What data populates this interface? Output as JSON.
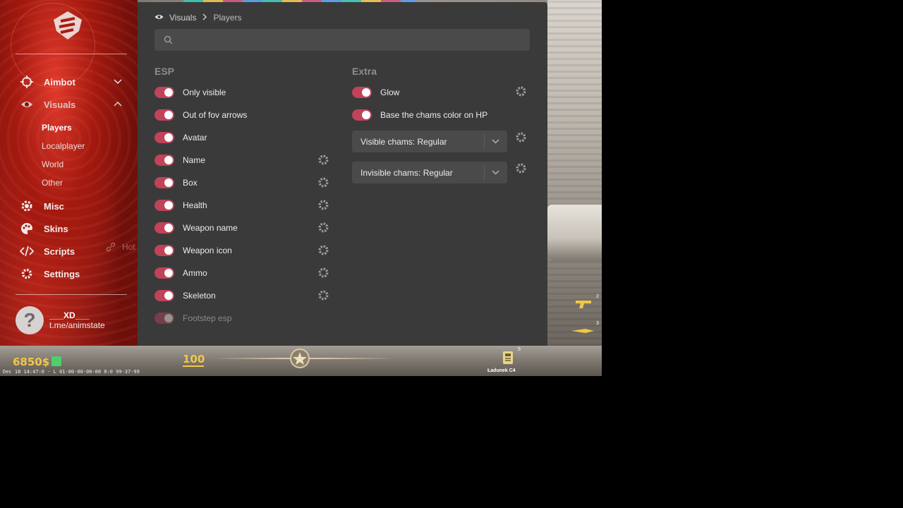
{
  "sidebar": {
    "nav": [
      {
        "label": "Aimbot",
        "icon": "crosshair-icon"
      },
      {
        "label": "Visuals",
        "icon": "eye-icon"
      },
      {
        "label": "Misc",
        "icon": "gear-icon"
      },
      {
        "label": "Skins",
        "icon": "palette-icon"
      },
      {
        "label": "Scripts",
        "icon": "code-icon"
      },
      {
        "label": "Settings",
        "icon": "settings-gear-icon"
      }
    ],
    "visuals_sub": [
      "Players",
      "Localplayer",
      "World",
      "Other"
    ],
    "ghost_hot": "Hot",
    "user": {
      "avatar_glyph": "?",
      "name": "___XD___",
      "link": "t.me/animstate"
    }
  },
  "breadcrumb": {
    "section": "Visuals",
    "page": "Players"
  },
  "search": {
    "placeholder": "",
    "value": ""
  },
  "esp": {
    "title": "ESP",
    "items": [
      {
        "label": "Only visible",
        "on": true,
        "gear": false
      },
      {
        "label": "Out of fov arrows",
        "on": true,
        "gear": false
      },
      {
        "label": "Avatar",
        "on": true,
        "gear": false
      },
      {
        "label": "Name",
        "on": true,
        "gear": true
      },
      {
        "label": "Box",
        "on": true,
        "gear": true
      },
      {
        "label": "Health",
        "on": true,
        "gear": true
      },
      {
        "label": "Weapon name",
        "on": true,
        "gear": true
      },
      {
        "label": "Weapon icon",
        "on": true,
        "gear": true
      },
      {
        "label": "Ammo",
        "on": true,
        "gear": true
      },
      {
        "label": "Skeleton",
        "on": true,
        "gear": true
      },
      {
        "label": "Footstep esp",
        "on": true,
        "gear": false,
        "faded": true
      }
    ]
  },
  "extra": {
    "title": "Extra",
    "items": [
      {
        "label": "Glow",
        "on": true,
        "gear": true
      },
      {
        "label": "Base the chams color on HP",
        "on": true,
        "gear": false
      }
    ],
    "selects": [
      {
        "label": "Visible chams: Regular"
      },
      {
        "label": "Invisible chams: Regular"
      }
    ]
  },
  "hud": {
    "money": "6850$",
    "health": "100",
    "timestamp": "Dec 18 14:47:0 - L 01-00-00-00-00 0:0 99-37-99",
    "bomb_label": "Ładunek C4",
    "bomb_count": "5",
    "slot_2": "2",
    "slot_3": "3"
  },
  "colors": {
    "toggle_on": "#c0435a",
    "panel_bg": "#3a3a3a",
    "hud_gold": "#f0c84a"
  }
}
